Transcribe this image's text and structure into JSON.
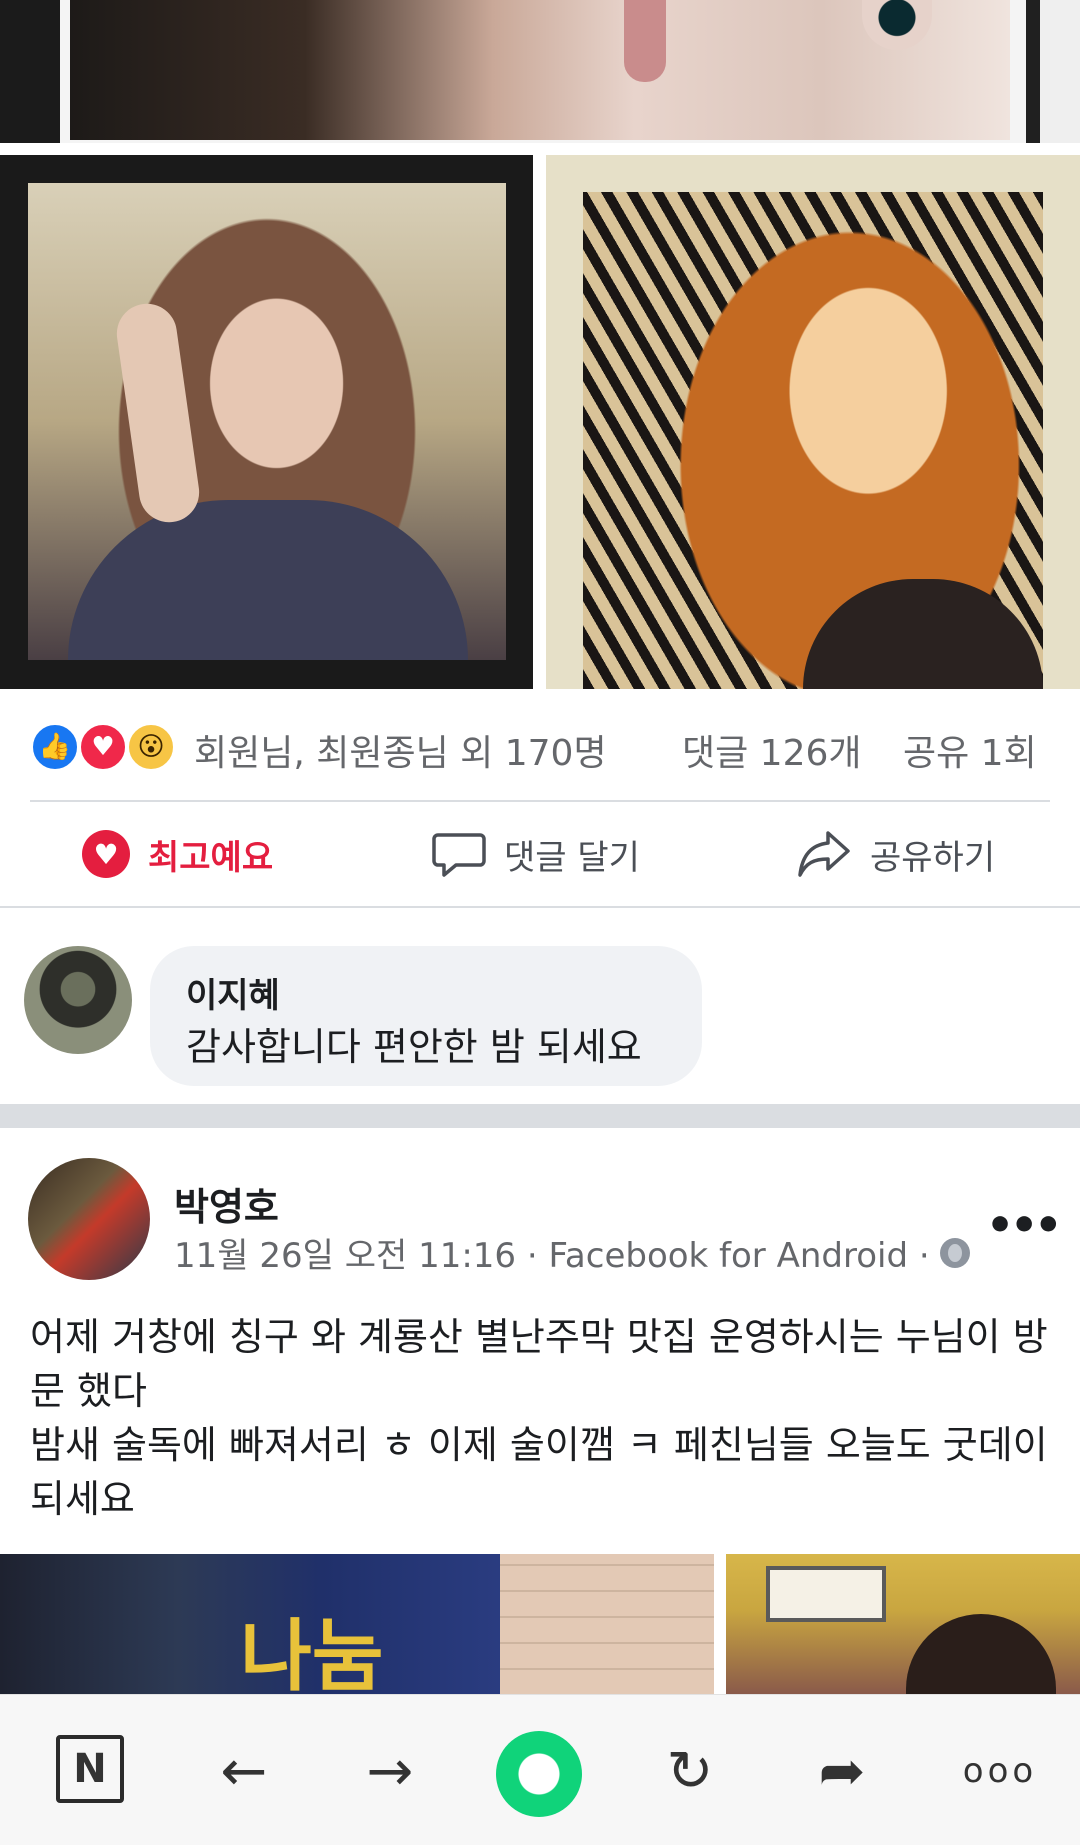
{
  "post1": {
    "reactions": {
      "icons": [
        "like-icon",
        "love-icon",
        "wow-icon"
      ],
      "summary": "회원님, 최원종님 외 170명",
      "comments": "댓글 126개",
      "shares": "공유 1회"
    },
    "actions": {
      "like_label": "최고예요",
      "comment_label": "댓글 달기",
      "share_label": "공유하기"
    },
    "comment": {
      "author": "이지혜",
      "text": "감사합니다 편안한 밤 되세요"
    }
  },
  "post2": {
    "author": "박영호",
    "meta": "11월 26일 오전 11:16 · Facebook for Android ·",
    "more": "•••",
    "text": "어제 거창에 칭구 와 계룡산 별난주막 맛집 운영하시는 누님이 방문 했다\n밤새 술독에 빠져서리 ㅎ 이제 술이깸 ㅋ 페친님들 오늘도 굿데이되세요",
    "photo_sign": "나눔"
  },
  "browser": {
    "naver_label": "N",
    "back_glyph": "←",
    "forward_glyph": "→",
    "reload_glyph": "↻",
    "share_glyph": "➦",
    "more_glyph": "ooo"
  },
  "colors": {
    "accent_love": "#e41e3f",
    "like_blue": "#1877f2",
    "home_green": "#10d37a"
  }
}
